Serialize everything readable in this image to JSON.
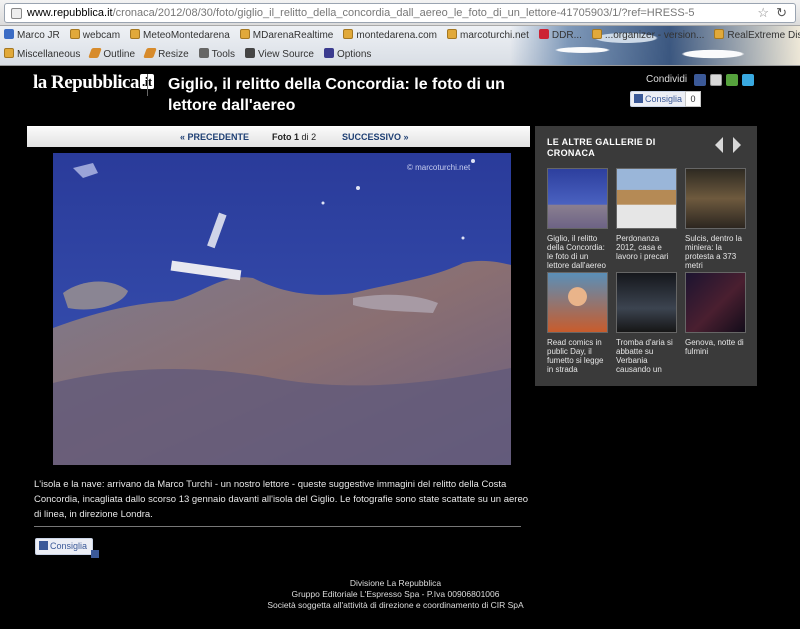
{
  "browser": {
    "url_domain": "www.repubblica.it",
    "url_path": "/cronaca/2012/08/30/foto/giglio_il_relitto_della_concordia_dall_aereo_le_foto_di_un_lettore-41705903/1/?ref=HRESS-5",
    "bookmarks_row1": [
      {
        "label": "Marco JR",
        "icon": "blue"
      },
      {
        "label": "webcam",
        "icon": "fold"
      },
      {
        "label": "MeteoMontedarena",
        "icon": "fold"
      },
      {
        "label": "MDarenaRealtime",
        "icon": "fold"
      },
      {
        "label": "montedarena.com",
        "icon": "fold"
      },
      {
        "label": "marcoturchi.net",
        "icon": "fold"
      },
      {
        "label": "DDR...",
        "icon": "w"
      },
      {
        "label": "...organizer - version...",
        "icon": "fold"
      },
      {
        "label": "RealExtreme Discussio...",
        "icon": "fold"
      }
    ],
    "bookmarks_row2": [
      {
        "label": "Miscellaneous",
        "icon": "fold"
      },
      {
        "label": "Outline",
        "icon": "pen"
      },
      {
        "label": "Resize",
        "icon": "pen"
      },
      {
        "label": "Tools",
        "icon": "tool"
      },
      {
        "label": "View Source",
        "icon": "view"
      },
      {
        "label": "Options",
        "icon": "opt"
      }
    ]
  },
  "header": {
    "logo_main": "la Repubblica",
    "logo_suffix": ".it",
    "title": "Giglio, il relitto della Concordia: le foto di un lettore dall'aereo",
    "share_label": "Condividi",
    "like_label": "Consiglia",
    "like_count": "0"
  },
  "gallery_nav": {
    "prev": "« PRECEDENTE",
    "photo_word": "Foto",
    "current": "1",
    "of": "di",
    "total": "2",
    "next": "SUCCESSIVO »"
  },
  "photo": {
    "credit": "© marcoturchi.net",
    "caption": "L'isola e la nave: arrivano da Marco Turchi - un nostro lettore - queste suggestive immagini del relitto della Costa Concordia, incagliata dallo scorso 13 gennaio davanti all'isola del Giglio. Le fotografie sono state scattate su un aereo di linea, in direzione Londra."
  },
  "bottom_like": "Consiglia",
  "side": {
    "title": "LE ALTRE GALLERIE DI CRONACA",
    "items": [
      {
        "label": "Giglio, il relitto della Concordia: le foto di un lettore dall'aereo",
        "tone": "sea"
      },
      {
        "label": "Perdonanza 2012, casa e lavoro i precari",
        "tone": "town"
      },
      {
        "label": "Sulcis, dentro la miniera: la protesta a 373 metri",
        "tone": "mine"
      },
      {
        "label": "Read comics in public Day, il fumetto si legge in strada",
        "tone": "comic"
      },
      {
        "label": "Tromba d'aria si abbatte su Verbania causando un",
        "tone": "storm"
      },
      {
        "label": "Genova, notte di fulmini",
        "tone": "night"
      }
    ]
  },
  "footer": {
    "line1": "Divisione La Repubblica",
    "line2": "Gruppo Editoriale L'Espresso Spa - P.Iva 00906801006",
    "line3": "Società soggetta all'attività di direzione e coordinamento di CIR SpA"
  }
}
